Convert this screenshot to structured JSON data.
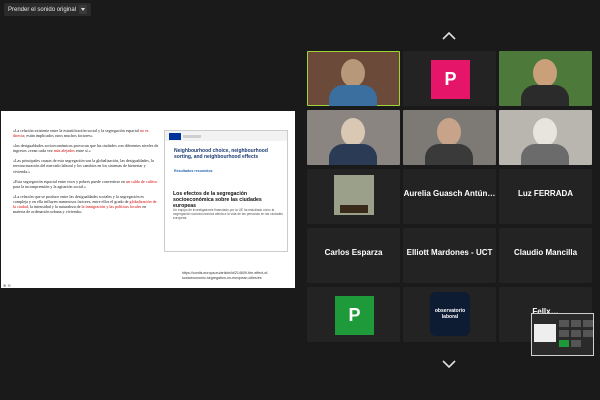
{
  "topbar": {
    "original_sound_label": "Prender el sonido original"
  },
  "share": {
    "paragraphs": [
      {
        "parts": [
          {
            "t": "«La relación existente entre la estratificación social y la segregación espacial "
          },
          {
            "t": "no es directa",
            "red": true
          },
          {
            "t": "; están implicados otros muchos factores»"
          }
        ]
      },
      {
        "parts": [
          {
            "t": "«las desigualdades socioeconómicas provocan que las ciudades con diferentes niveles de ingresos «vean cada vez "
          },
          {
            "t": "más alejados",
            "red": true
          },
          {
            "t": " entre sí.»"
          }
        ]
      },
      {
        "parts": [
          {
            "t": "«Las principales causas de esta segregación son la globalización, las desigualdades, la reestructuración del mercado laboral y los cambios en los sistemas de bienestar y vivienda.»"
          }
        ]
      },
      {
        "parts": [
          {
            "t": "«Esta segregación espacial entre ricos y pobres puede convertirse en "
          },
          {
            "t": "un caldo de cultivo",
            "red": true
          },
          {
            "t": " para la incomprensión y la agitación social.»"
          }
        ]
      },
      {
        "parts": [
          {
            "t": "«La relación que se produce entre las desigualdades sociales y la segregación es compleja y en ella influyen numerosos factores, entre ellos el grado de "
          },
          {
            "t": "globalización de la ciudad",
            "red": true
          },
          {
            "t": ", la intensidad y la naturaleza de "
          },
          {
            "t": "la inmigración y las políticas locales",
            "red": true
          },
          {
            "t": " en materia de ordenación urbana y vivienda»"
          }
        ]
      }
    ],
    "card": {
      "title": "Neighbourhood choice, neighbourhood sorting, and neighbourhood effects",
      "tag": "Resultados resumidos",
      "subtitle": "Los efectos de la segregación socioeconómica sobre las ciudades europeas",
      "body": "Un equipo de investigadores financiado por la UE ha estudiado cómo la segregación socioeconómica afecta a la vida de las personas en las ciudades europeas."
    },
    "source_url": "https://cordis.europa.eu/article/id/214609-the-effect-of-socioeconomic-segregation-on-european-cities/es",
    "zoom_label": "⊕ ⊖"
  },
  "participants": [
    {
      "name": "",
      "type": "video",
      "active": true
    },
    {
      "name": "P",
      "type": "avatar",
      "color": "#e5166a"
    },
    {
      "name": "",
      "type": "video"
    },
    {
      "name": "",
      "type": "video"
    },
    {
      "name": "",
      "type": "video"
    },
    {
      "name": "",
      "type": "video"
    },
    {
      "name": "",
      "type": "image"
    },
    {
      "name": "Aurelia Guasch Antún…",
      "type": "name"
    },
    {
      "name": "Luz FERRADA",
      "type": "name"
    },
    {
      "name": "Carlos Esparza",
      "type": "name"
    },
    {
      "name": "Elliott Mardones - UCT",
      "type": "name"
    },
    {
      "name": "Claudio Mancilla",
      "type": "name"
    },
    {
      "name": "P",
      "type": "avatar",
      "color": "#1f9a3a"
    },
    {
      "name": "observatorio laboral",
      "type": "logo"
    },
    {
      "name": "Fellx…",
      "type": "name"
    }
  ],
  "colors": {
    "active_border": "#a0d33a",
    "avatar_pink": "#e5166a",
    "avatar_green": "#1f9a3a",
    "logo_blue": "#1e4d8f"
  }
}
